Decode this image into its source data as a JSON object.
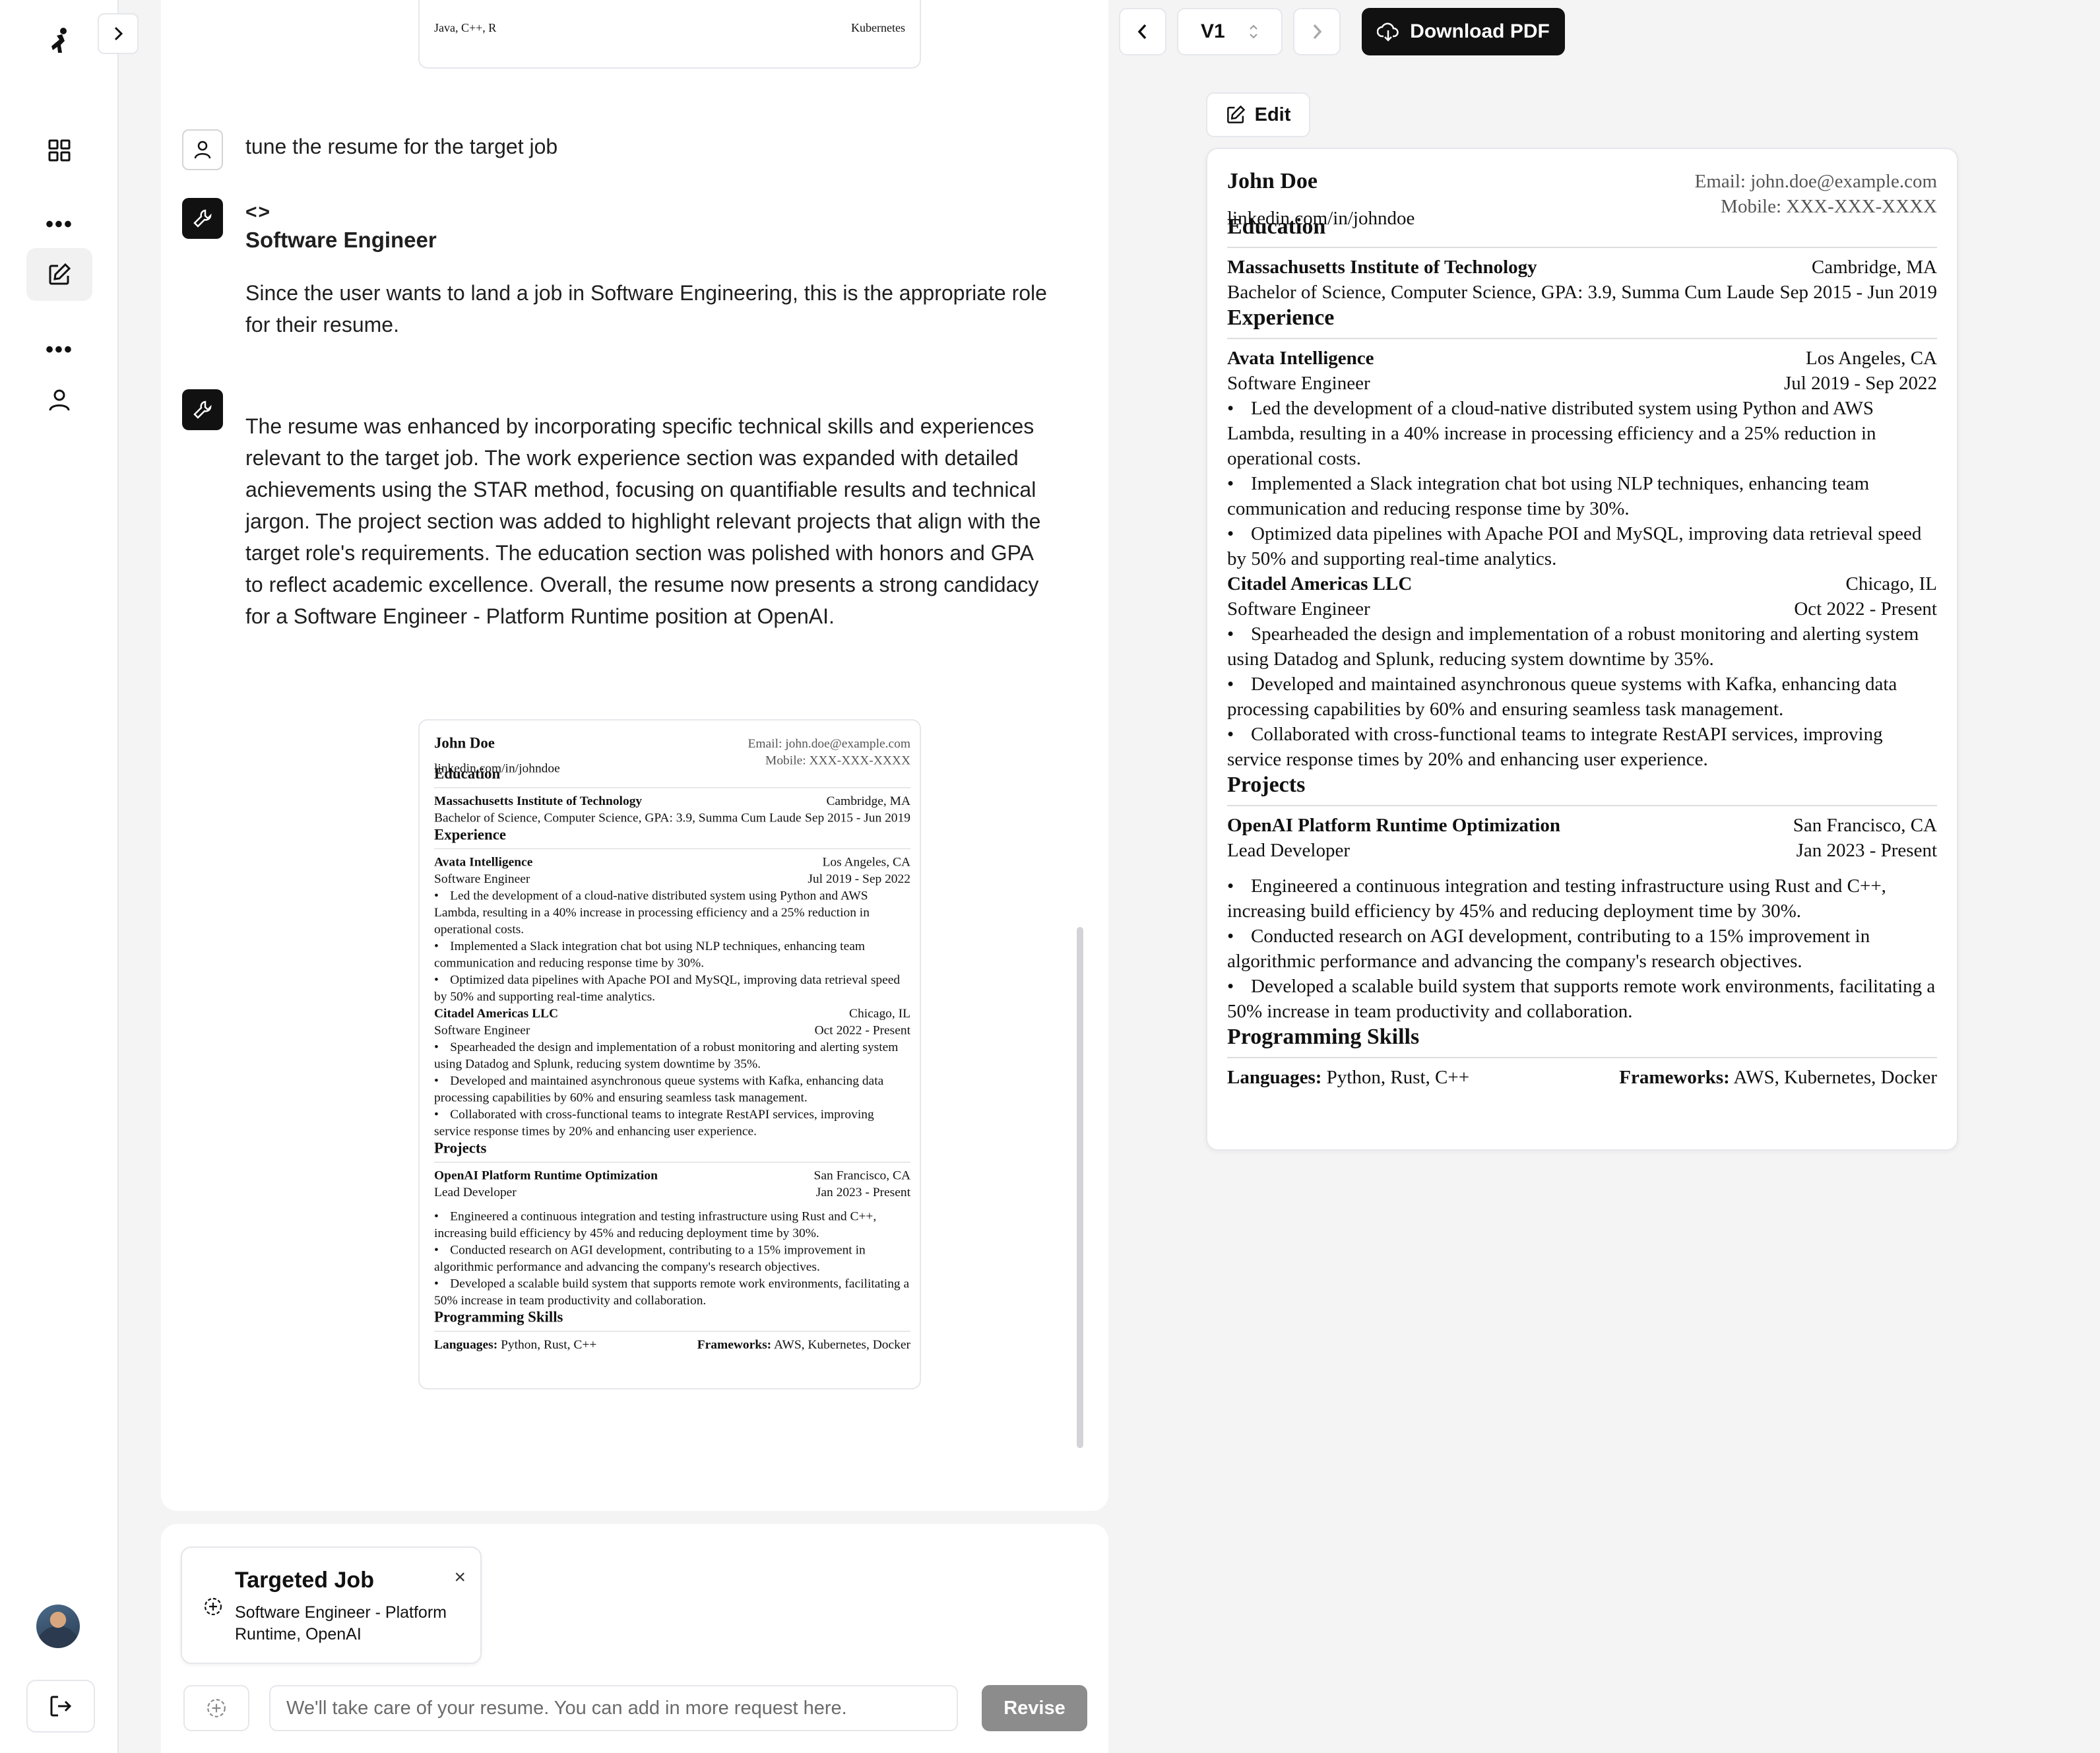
{
  "chat": {
    "top_card": {
      "left": "Java, C++, R",
      "right": "Kubernetes"
    },
    "messages": [
      {
        "role": "user",
        "text": "tune the resume for the target job"
      },
      {
        "role": "tool",
        "code_glyph": "<>",
        "title": "Software Engineer",
        "text": "Since the user wants to land a job in Software Engineering, this is the appropriate role for their resume."
      },
      {
        "role": "tool",
        "text": "The resume was enhanced by incorporating specific technical skills and experiences relevant to the target job. The work experience section was expanded with detailed achievements using the STAR method, focusing on quantifiable results and technical jargon. The project section was added to highlight relevant projects that align with the target role's requirements. The education section was polished with honors and GPA to reflect academic excellence. Overall, the resume now presents a strong candidacy for a Software Engineer - Platform Runtime position at OpenAI."
      }
    ]
  },
  "composer": {
    "job_card": {
      "title": "Targeted Job",
      "subtitle": "Software Engineer - Platform Runtime, OpenAI",
      "close": "×"
    },
    "input_placeholder": "We'll take care of your resume. You can add in more request here.",
    "revise_label": "Revise"
  },
  "toolbar": {
    "version": "V1",
    "download_label": "Download PDF",
    "edit_label": "Edit"
  },
  "resume": {
    "name": "John Doe",
    "linkedin": "linkedin.com/in/johndoe",
    "email": "Email: john.doe@example.com",
    "mobile": "Mobile: XXX-XXX-XXXX",
    "sections": {
      "education": "Education",
      "experience": "Experience",
      "projects": "Projects",
      "skills": "Programming Skills"
    },
    "education": {
      "school": "Massachusetts Institute of Technology",
      "location": "Cambridge, MA",
      "degree": "Bachelor of Science, Computer Science, GPA: 3.9, Summa Cum Laude",
      "dates": "Sep 2015 - Jun 2019"
    },
    "experience": [
      {
        "company": "Avata Intelligence",
        "location": "Los Angeles, CA",
        "role": "Software Engineer",
        "dates": "Jul 2019 - Sep 2022",
        "bullets": [
          "Led the development of a cloud-native distributed system using Python and AWS Lambda, resulting in a 40% increase in processing efficiency and a 25% reduction in operational costs.",
          "Implemented a Slack integration chat bot using NLP techniques, enhancing team communication and reducing response time by 30%.",
          "Optimized data pipelines with Apache POI and MySQL, improving data retrieval speed by 50% and supporting real-time analytics."
        ]
      },
      {
        "company": "Citadel Americas LLC",
        "location": "Chicago, IL",
        "role": "Software Engineer",
        "dates": "Oct 2022 - Present",
        "bullets": [
          "Spearheaded the design and implementation of a robust monitoring and alerting system using Datadog and Splunk, reducing system downtime by 35%.",
          "Developed and maintained asynchronous queue systems with Kafka, enhancing data processing capabilities by 60% and ensuring seamless task management.",
          "Collaborated with cross-functional teams to integrate RestAPI services, improving service response times by 20% and enhancing user experience."
        ]
      }
    ],
    "project": {
      "name": "OpenAI Platform Runtime Optimization",
      "location": "San Francisco, CA",
      "role": "Lead Developer",
      "dates": "Jan 2023 - Present",
      "bullets": [
        "Engineered a continuous integration and testing infrastructure using Rust and C++, increasing build efficiency by 45% and reducing deployment time by 30%.",
        "Conducted research on AGI development, contributing to a 15% improvement in algorithmic performance and advancing the company's research objectives.",
        "Developed a scalable build system that supports remote work environments, facilitating a 50% increase in team productivity and collaboration."
      ]
    },
    "skills": {
      "languages_label": "Languages:",
      "languages": "Python, Rust, C++",
      "frameworks_label": "Frameworks:",
      "frameworks": "AWS, Kubernetes, Docker"
    }
  }
}
